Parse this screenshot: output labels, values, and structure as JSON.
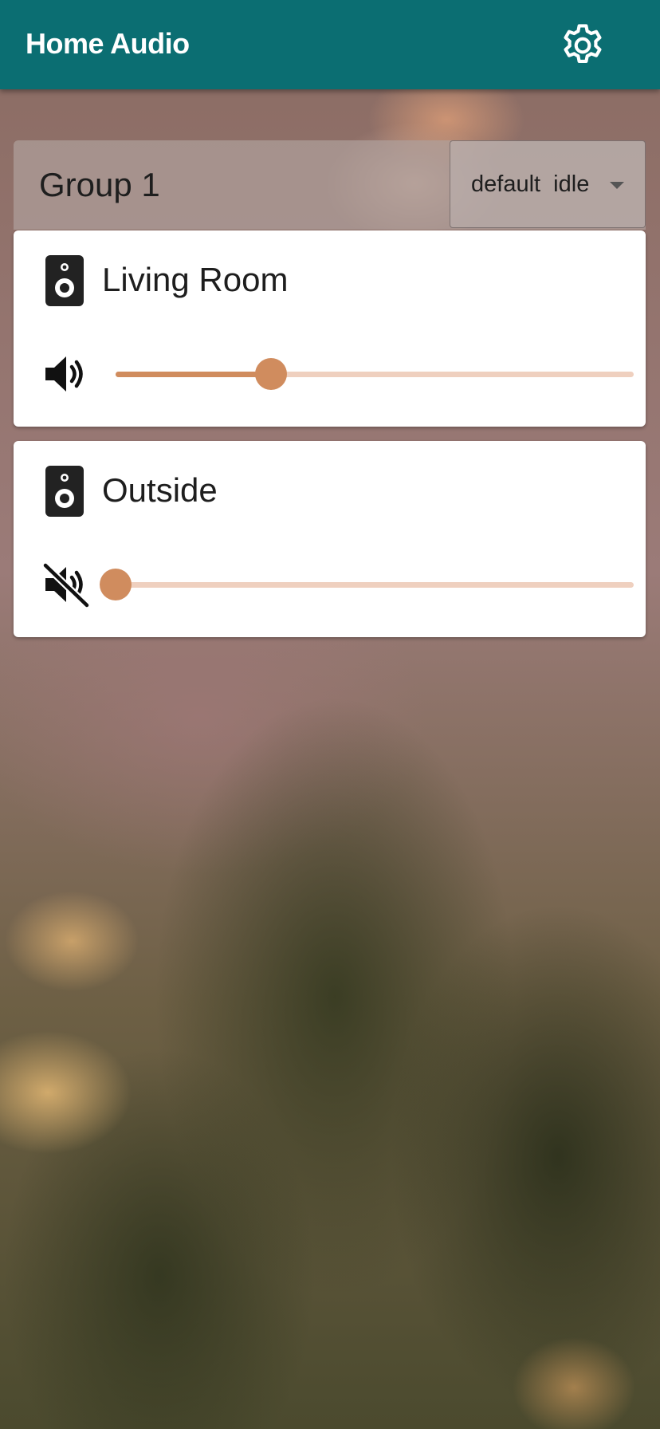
{
  "app": {
    "title": "Home Audio"
  },
  "theme": {
    "appbar_color": "#0b6e72",
    "accent_color": "#d08c5e",
    "track_color": "#efd0bf",
    "text_color": "#1e1e1e"
  },
  "group": {
    "title": "Group 1",
    "mode": "default  idle"
  },
  "zones": [
    {
      "name": "Living Room",
      "icon": "speaker-icon",
      "volume_icon": "volume-up-icon",
      "muted": false,
      "volume_fraction": 0.3
    },
    {
      "name": "Outside",
      "icon": "speaker-icon",
      "volume_icon": "volume-mute-icon",
      "muted": true,
      "volume_fraction": 0.0
    }
  ]
}
